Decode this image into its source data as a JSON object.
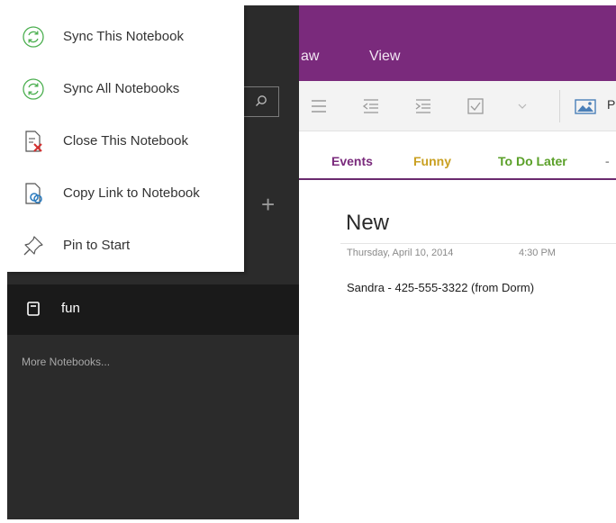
{
  "ribbon": {
    "tabs": [
      {
        "label": "aw"
      },
      {
        "label": "View"
      }
    ],
    "picture_label": "P"
  },
  "sections": {
    "tabs": [
      {
        "label": "Events"
      },
      {
        "label": "Funny"
      },
      {
        "label": "To Do Later"
      }
    ]
  },
  "page": {
    "title": "New",
    "date": "Thursday, April 10, 2014",
    "time": "4:30 PM",
    "body": "Sandra - 425-555-3322 (from Dorm)"
  },
  "sidebar": {
    "notebook": {
      "label": "fun"
    },
    "more_notebooks": "More Notebooks..."
  },
  "context_menu": {
    "items": [
      {
        "label": "Sync This Notebook",
        "icon": "sync-icon"
      },
      {
        "label": "Sync All Notebooks",
        "icon": "sync-icon"
      },
      {
        "label": "Close This Notebook",
        "icon": "close-notebook-icon"
      },
      {
        "label": "Copy Link to Notebook",
        "icon": "copy-link-icon"
      },
      {
        "label": "Pin to Start",
        "icon": "pin-icon"
      }
    ]
  },
  "colors": {
    "accent_purple": "#7a2a7c",
    "sidebar_bg": "#2b2b2b",
    "selected_item_bg": "#1a1a1a",
    "sync_green": "#4caf50",
    "events_color": "#7a2a7c",
    "funny_color": "#c9a021",
    "todo_color": "#5aa028"
  }
}
